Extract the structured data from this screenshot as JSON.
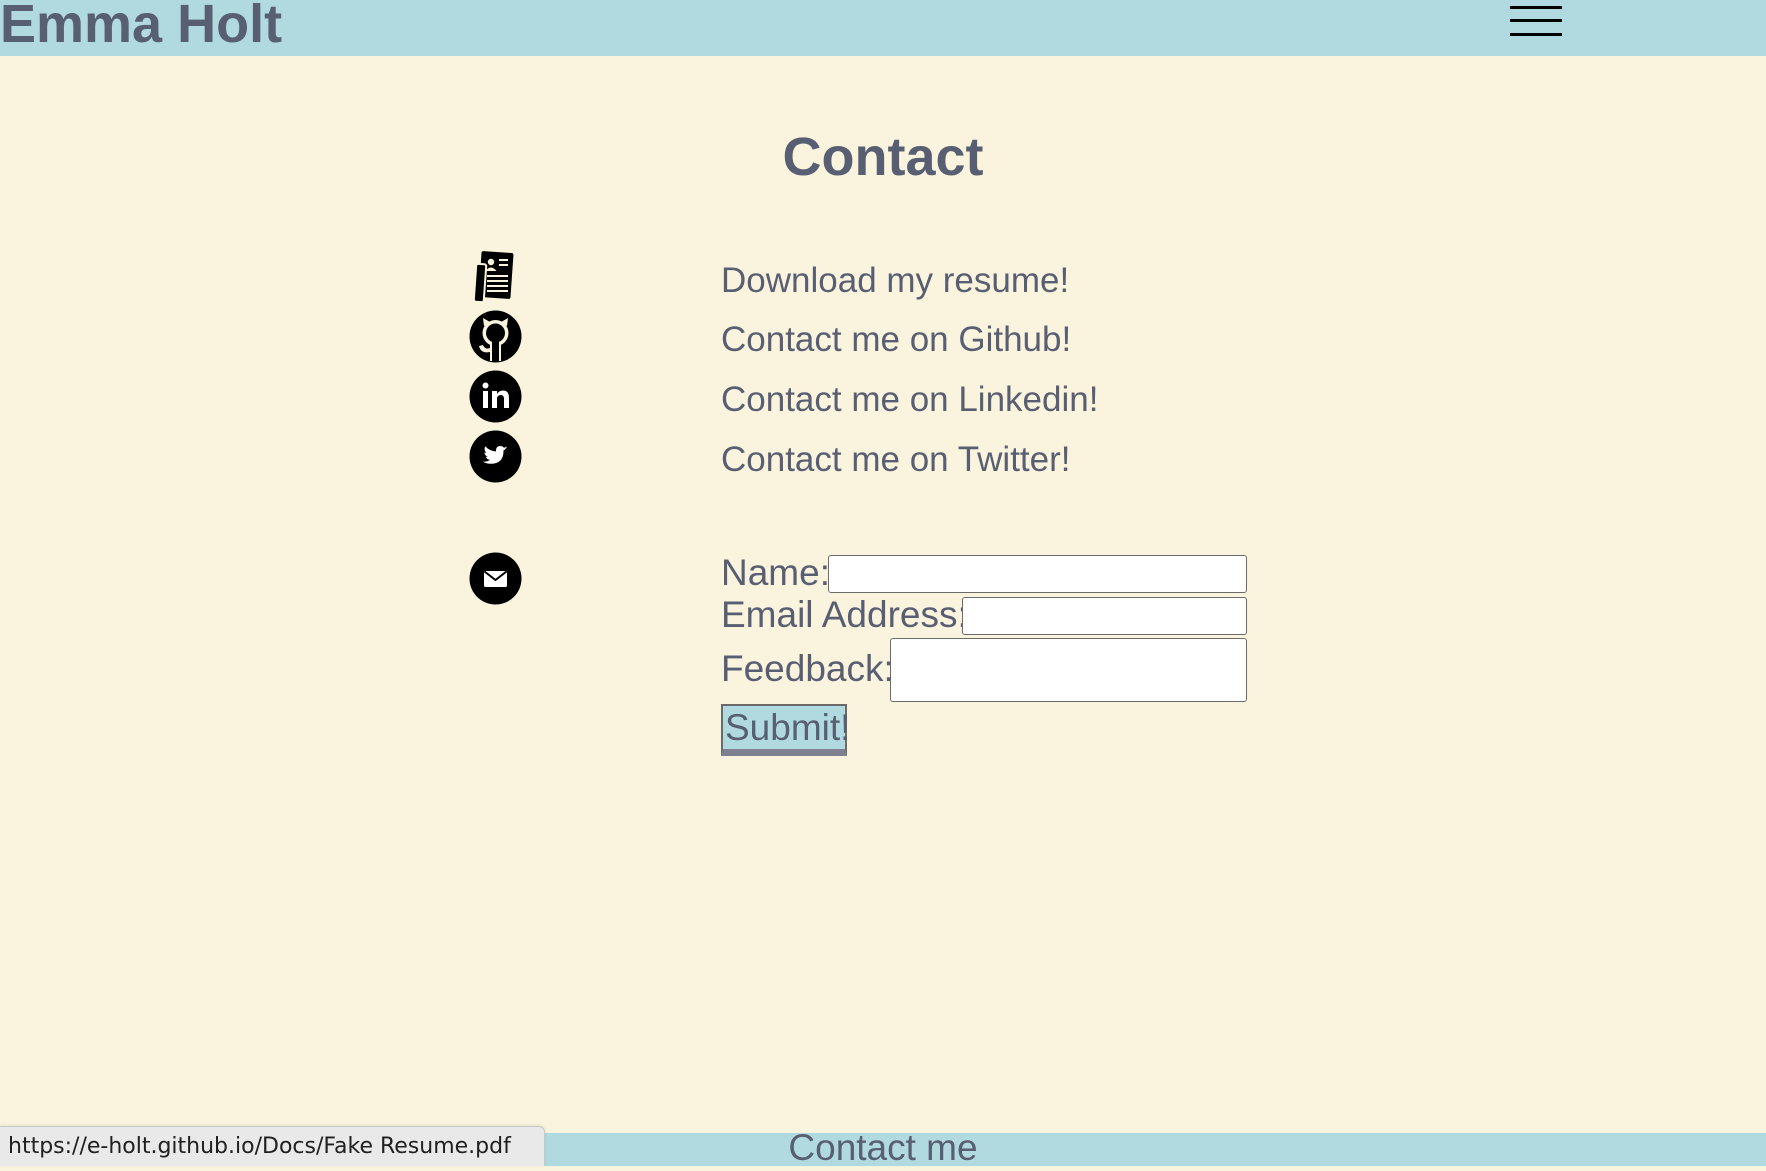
{
  "header": {
    "site_name": "Emma Holt",
    "menu_icon": "hamburger-menu-icon",
    "background": "#b0dae0"
  },
  "main": {
    "title": "Contact",
    "links": [
      {
        "icon": "resume-document-icon",
        "label": "Download my resume!"
      },
      {
        "icon": "github-icon",
        "label": "Contact me on Github!"
      },
      {
        "icon": "linkedin-icon",
        "label": "Contact me on Linkedin!"
      },
      {
        "icon": "twitter-icon",
        "label": "Contact me on Twitter!"
      }
    ],
    "form": {
      "icon": "mail-icon",
      "name_label": "Name:",
      "name_value": "",
      "email_label": "Email Address:",
      "email_value": "",
      "feedback_label": "Feedback:",
      "feedback_value": "",
      "submit_label": "Submit!"
    }
  },
  "footer": {
    "text": "Contact me"
  },
  "status_bar": {
    "url": "https://e-holt.github.io/Docs/Fake Resume.pdf"
  },
  "colors": {
    "page_background": "#faf3dd",
    "accent": "#b0dae0",
    "text": "#595f72"
  }
}
